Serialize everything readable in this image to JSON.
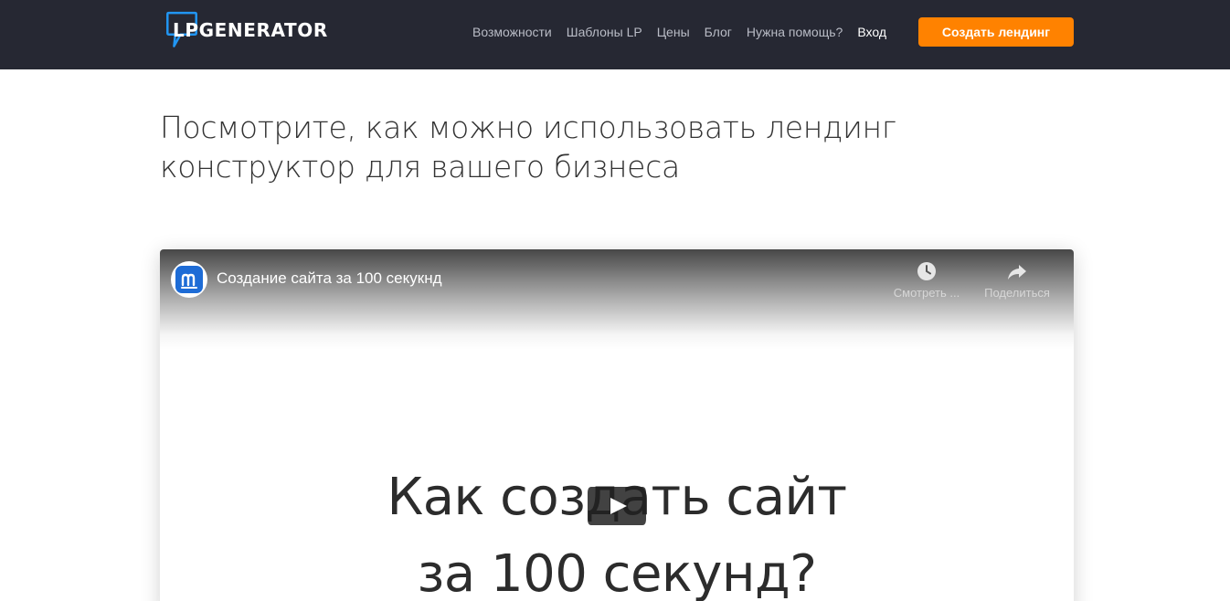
{
  "header": {
    "logo_text": "LPGENERATOR",
    "nav": [
      {
        "label": "Возможности"
      },
      {
        "label": "Шаблоны LP"
      },
      {
        "label": "Цены"
      },
      {
        "label": "Блог"
      },
      {
        "label": "Нужна помощь?"
      },
      {
        "label": "Вход"
      }
    ],
    "cta_label": "Создать лендинг"
  },
  "headline": {
    "line1": "Посмотрите, как можно использовать лендинг",
    "line2": "конструктор для вашего бизнеса"
  },
  "video": {
    "title": "Создание сайта за 100 секукнд",
    "watch_later_label": "Смотреть ...",
    "share_label": "Поделиться",
    "caption_line1": "Как создать сайт",
    "caption_line2": "за 100 секунд?"
  },
  "icons": {
    "logo": "speech-bubble-icon",
    "channel": "channel-avatar-icon",
    "watch_later": "clock-icon",
    "share": "share-arrow-icon",
    "play": "play-icon"
  },
  "colors": {
    "header_bg": "#262833",
    "nav_text": "#b9bcc6",
    "cta_bg": "#ff8200",
    "logo_accent": "#2196f3",
    "play_bg": "#212121"
  }
}
